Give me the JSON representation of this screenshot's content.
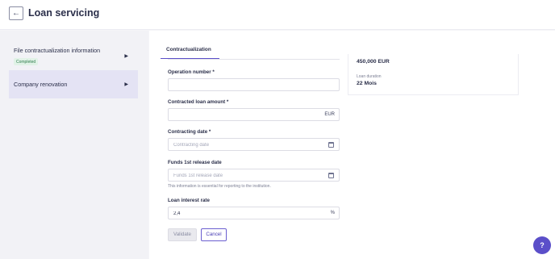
{
  "header": {
    "back_icon": "arrow-left-icon",
    "back_glyph": "←",
    "title": "Loan servicing"
  },
  "sidebar": {
    "items": [
      {
        "label": "File contractualization information",
        "badge": "Completed",
        "arrow": "▶",
        "active": false
      },
      {
        "label": "Company renovation",
        "arrow": "▶",
        "active": true
      }
    ]
  },
  "tabs": [
    {
      "label": "Contractualization",
      "active": true
    }
  ],
  "form": {
    "operation_number": {
      "label": "Operation number *",
      "value": "",
      "placeholder": ""
    },
    "contracted_loan_amount": {
      "label": "Contracted loan amount *",
      "value": "",
      "placeholder": "",
      "suffix": "EUR"
    },
    "contracting_date": {
      "label": "Contracting date *",
      "value": "",
      "placeholder": "Contracting date"
    },
    "funds_release_date": {
      "label": "Funds 1st release date",
      "value": "",
      "placeholder": "Funds 1st release date",
      "helper": "This information is essential for reporting to the institution."
    },
    "loan_interest_rate": {
      "label": "Loan interest rate",
      "value": "2,4",
      "placeholder": "",
      "suffix": "%"
    },
    "validate_label": "Validate",
    "cancel_label": "Cancel"
  },
  "summary": {
    "amount_value": "450,000 EUR",
    "duration_label": "Loan duration",
    "duration_value": "22 Mois"
  },
  "help": {
    "glyph": "?",
    "icon": "help-icon"
  },
  "colors": {
    "accent": "#5b4fc9",
    "badge_bg": "#e1f2e7",
    "badge_text": "#2f7d4d",
    "active_item_bg": "#e4e3f4"
  }
}
